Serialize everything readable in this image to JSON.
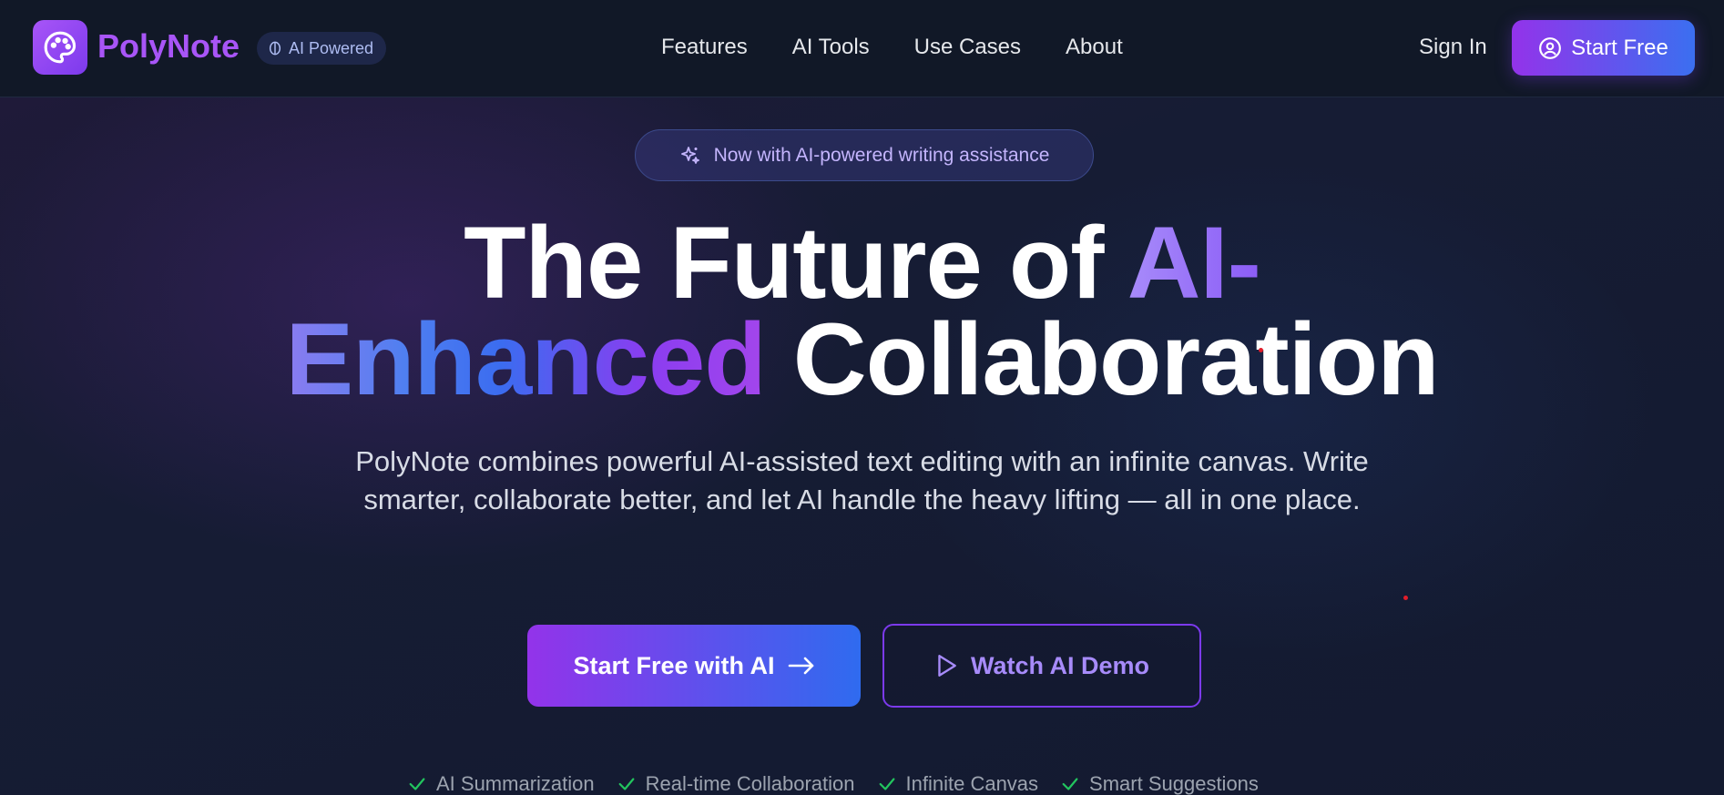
{
  "brand": {
    "name": "PolyNote",
    "badge": "AI Powered",
    "logo_icon": "palette-icon",
    "accent": "#a855f7"
  },
  "nav": {
    "links": [
      "Features",
      "AI Tools",
      "Use Cases",
      "About"
    ],
    "sign_in": "Sign In",
    "start_free": "Start Free",
    "start_free_icon": "user-circle-icon"
  },
  "hero": {
    "announcement": "Now with AI-powered writing assistance",
    "announcement_icon": "sparkles-icon",
    "headline_line1_plain": "The Future of ",
    "headline_line1_accent": "AI-",
    "headline_line2_accent": "Enhanced",
    "headline_line2_plain": " Collaboration",
    "subtitle": "PolyNote combines powerful AI-assisted text editing with an infinite canvas. Write smarter, collaborate better, and let AI handle the heavy lifting — all in one place.",
    "cta_primary": "Start Free with AI",
    "cta_primary_icon": "arrow-right-icon",
    "cta_secondary": "Watch AI Demo",
    "cta_secondary_icon": "play-icon"
  },
  "features": [
    "AI Summarization",
    "Real-time Collaboration",
    "Infinite Canvas",
    "Smart Suggestions"
  ],
  "colors": {
    "gradient_start": "#9333ea",
    "gradient_end": "#2f6bef",
    "check_green": "#22c55e"
  }
}
